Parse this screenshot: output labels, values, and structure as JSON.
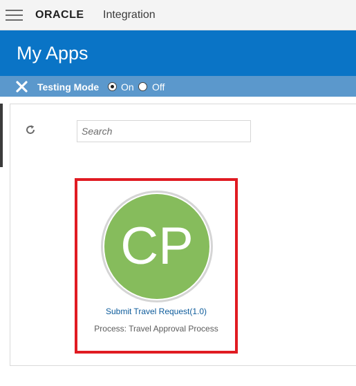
{
  "header": {
    "brand": "ORACLE",
    "product": "Integration",
    "menu_icon": "hamburger-menu-icon"
  },
  "banner": {
    "title": "My Apps",
    "color": "#0a74c6"
  },
  "testing_mode": {
    "label": "Testing Mode",
    "on_label": "On",
    "off_label": "Off",
    "selected": "On",
    "close_icon": "close-icon"
  },
  "toolbar": {
    "refresh_icon": "refresh-icon",
    "search_placeholder": "Search"
  },
  "apps": [
    {
      "initials": "CP",
      "name": "Submit Travel Request(1.0)",
      "description": "Process: Travel Approval Process",
      "avatar_color": "#86bc5c",
      "highlight_color": "#e01b22"
    }
  ]
}
